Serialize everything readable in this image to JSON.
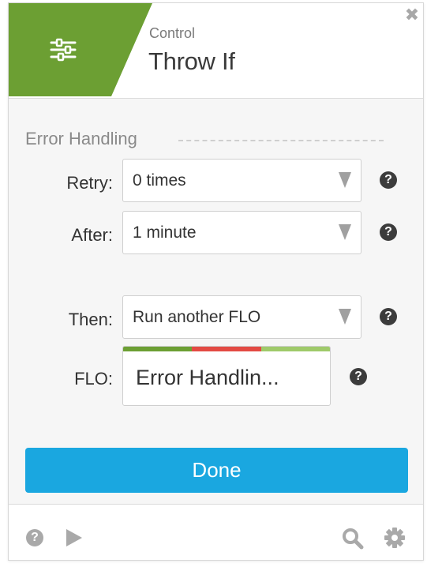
{
  "header": {
    "category": "Control",
    "title": "Throw If",
    "accent_color": "#6c9f33",
    "icon": "sliders-icon",
    "close_icon": "close-icon"
  },
  "error_handling": {
    "section_title": "Error Handling",
    "fields": {
      "retry": {
        "label": "Retry:",
        "value": "0 times"
      },
      "after": {
        "label": "After:",
        "value": "1 minute"
      },
      "then": {
        "label": "Then:",
        "value": "Run another FLO"
      },
      "flo": {
        "label": "FLO:",
        "value": "Error Handlin..."
      }
    },
    "flo_strip_colors": [
      "#6c9f33",
      "#e34a43",
      "#9fca6a"
    ],
    "help_icon": "question-circle-icon"
  },
  "actions": {
    "done_label": "Done",
    "done_color": "#1aa7e0"
  },
  "footer": {
    "help_icon": "question-circle-icon",
    "play_icon": "play-icon",
    "search_icon": "search-icon",
    "settings_icon": "gear-icon"
  }
}
